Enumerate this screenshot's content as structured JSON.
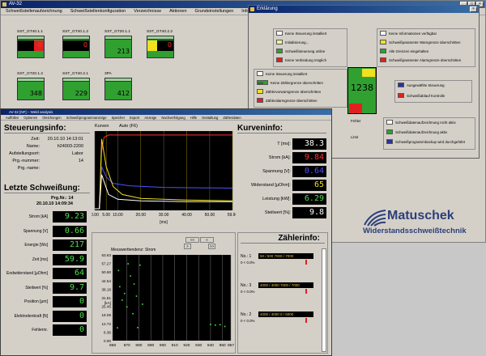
{
  "back_window": {
    "title": "AV-32",
    "menu": [
      "Schweißstellenaufzeichnung",
      "Schweißstellenkonfiguration",
      "Verzeichnisse",
      "Aktionen",
      "Grundeinstellungen",
      "Info"
    ],
    "tiles": [
      {
        "label": "SST_GT40.1.1",
        "value": "0",
        "style": "black-red"
      },
      {
        "label": "SST_GT40.1.2",
        "value": "0",
        "style": "black"
      },
      {
        "label": "SST_GT20.1.1",
        "value": "213",
        "style": "green"
      },
      {
        "label": "SST_GT40.2.2",
        "value": "0",
        "style": "yellow-black"
      },
      {
        "label": "SST_GT20.1.2",
        "value": "348",
        "style": "green"
      },
      {
        "label": "SST_GT40.2.1",
        "value": "229",
        "style": "green"
      },
      {
        "label": "3PA",
        "value": "412",
        "style": "green"
      }
    ]
  },
  "legend_window": {
    "title": "Erklärung",
    "center_value": "1238",
    "left_items": [
      {
        "text": "Keine Steuerung installiert",
        "color": "#ffffff"
      },
      {
        "text": "Initialisierung...",
        "color": "#f0f0a0"
      },
      {
        "text": "Schweißsteuerung online",
        "color": "#30a030"
      },
      {
        "text": "Keine Verbindung möglich",
        "color": "#e02020"
      }
    ],
    "right_items": [
      {
        "text": "Keine Informationen verfügbar",
        "color": "#ffffff"
      },
      {
        "text": "Schweißparameter Warngrenze überschritten",
        "color": "#f0e020"
      },
      {
        "text": "Alle Grenzen eingehalten",
        "color": "#30a030"
      },
      {
        "text": "Schweißparameter Alarmgrenze überschritten",
        "color": "#e02020"
      }
    ],
    "mid_items": [
      {
        "text": "Keine Steuerung installiert",
        "color": "#ffffff",
        "prefix": ""
      },
      {
        "text": "Keine Zählergrenze überschritten",
        "color": "#30a030",
        "prefix": "123"
      },
      {
        "text": "Zählervorwarngrenze überschritten",
        "color": "#f0e020",
        "prefix": ""
      },
      {
        "text": "Zähleralarmgrenze überschritten",
        "color": "#e02020",
        "prefix": ""
      }
    ],
    "side_items": [
      {
        "text": "Ausgewählte Steuerung",
        "color": "#3030a0"
      },
      {
        "text": "Schweißablauf Kontrolle",
        "color": "#e02020"
      }
    ],
    "bottom_items": [
      {
        "text": "Schweißdatenaufzeichnung nicht aktiv",
        "color": "#ffffff"
      },
      {
        "text": "Schweißdatenaufzeichnung aktiv",
        "color": "#30a030"
      },
      {
        "text": "Schweißprogrammbackup wird durchgeführt",
        "color": "#3030a0"
      }
    ],
    "partial_items": [
      "Fehler",
      "Limit"
    ]
  },
  "brand": {
    "name": "Matuschek",
    "subtitle": "Widerstandsschweißtechnik"
  },
  "main_window": {
    "title": "AV-32  [NF] – Weld analysis",
    "menu": [
      "Auffüllen",
      "Optionen",
      "Gleichungen",
      "Schweißprogrammanzeige",
      "Speicher",
      "Export",
      "Anzeige",
      "Nachverfolgung",
      "Hilfe",
      "Gestaltung",
      "Zählerdaten"
    ],
    "steuerung": {
      "heading": "Steuerungsinfo:",
      "rows": [
        {
          "label": "Zeit:",
          "value": "20.10.10 14:13:01"
        },
        {
          "label": "Name:",
          "value": "h24003-2200"
        },
        {
          "label": "Aufstellungsort:",
          "value": "Labor"
        },
        {
          "label": "Prg.-nummer:",
          "value": "14"
        },
        {
          "label": "Prg.-name:",
          "value": ""
        }
      ]
    },
    "weld": {
      "heading": "Letzte Schweißung:",
      "prg": "Prg.Nr.: 14",
      "datetime": "20.10.10     14:09:34",
      "rows": [
        {
          "label": "Strom [kA]",
          "value": "9.23"
        },
        {
          "label": "Spannung [V]",
          "value": "0.66"
        },
        {
          "label": "Energie [Ws]",
          "value": "217"
        },
        {
          "label": "Zeit [ms]",
          "value": "59.9"
        },
        {
          "label": "Endwiderstand [µOhm]",
          "value": "64"
        },
        {
          "label": "Steilwert [%]",
          "value": "9.7"
        },
        {
          "label": "Position [µm]",
          "value": "0"
        },
        {
          "label": "Elektrodenkraft [N]",
          "value": "0"
        },
        {
          "label": "Fehlernr.",
          "value": "0"
        }
      ]
    },
    "curve_tabs": {
      "curves": "Kurven",
      "auto": "Auto (F6)"
    },
    "kurven": {
      "heading": "Kurveninfo:",
      "rows": [
        {
          "label": "T [ms]:",
          "value": "38.3",
          "color": "#ffffff",
          "bg": "#000"
        },
        {
          "label": "Strom [kA]:",
          "value": "9.84",
          "color": "#ff3030",
          "bg": "#000"
        },
        {
          "label": "Spannung [V]:",
          "value": "0.64",
          "color": "#5050ff",
          "bg": "#000"
        },
        {
          "label": "Widerstand [µOhm]:",
          "value": "65",
          "color": "#f0e020",
          "bg": "#000"
        },
        {
          "label": "Leistung [kW]:",
          "value": "6.29",
          "color": "#4fe04f",
          "bg": "#000"
        },
        {
          "label": "Steilwert [%]:",
          "value": "9.8",
          "color": "#ffffff",
          "bg": "#000"
        }
      ]
    },
    "trend": {
      "title": "Messwerttendenz:  Strom",
      "nav": [
        "<<",
        "<",
        ">",
        ">>"
      ]
    },
    "zaehler": {
      "heading": "Zählerinfo:",
      "rows": [
        {
          "no": "No.: 1",
          "text": "50 / 500   7000 / 7000",
          "pct": "0 < 0.0%"
        },
        {
          "no": "No.: 3",
          "text": "4000 / 4000   7000 / 7000",
          "pct": "0 < 0.0%"
        },
        {
          "no": "No.: 2",
          "text": "4000 / 4000   0 / 5000",
          "pct": "0 < 0.0%"
        }
      ]
    }
  },
  "chart_data": [
    {
      "type": "line",
      "title": "",
      "xlabel": "[ms]",
      "ylabel": "",
      "x_ticks": [
        "0.00",
        "5.00",
        "10.00",
        "20.00",
        "30.00",
        "40.00",
        "50.00",
        "59.90"
      ],
      "xlim": [
        0,
        59.9
      ],
      "grid": true,
      "series": [
        {
          "color": "#ff3030",
          "x": [
            0,
            2,
            3,
            4,
            6,
            10,
            20,
            40,
            59.9
          ],
          "y": [
            0.02,
            0.02,
            0.75,
            0.92,
            0.95,
            0.95,
            0.95,
            0.95,
            0.95
          ]
        },
        {
          "color": "#5050ff",
          "x": [
            0,
            2,
            3,
            5,
            8,
            15,
            30,
            59.9
          ],
          "y": [
            0.02,
            0.02,
            0.55,
            0.42,
            0.34,
            0.31,
            0.29,
            0.28
          ]
        },
        {
          "color": "#f0e020",
          "x": [
            0,
            2,
            3,
            5,
            8,
            12,
            20,
            40,
            59.9
          ],
          "y": [
            0.02,
            0.02,
            0.9,
            0.55,
            0.3,
            0.2,
            0.15,
            0.13,
            0.12
          ]
        },
        {
          "color": "#ffffff",
          "x": [
            0,
            2,
            3,
            6,
            10,
            20,
            40,
            59.9
          ],
          "y": [
            0.02,
            0.02,
            0.45,
            0.2,
            0.14,
            0.12,
            0.11,
            0.11
          ]
        }
      ]
    },
    {
      "type": "scatter",
      "title": "Messwerttendenz:  Strom",
      "xlabel": "",
      "ylabel": "[kA]",
      "y_ticks": [
        "63.63",
        "57.27",
        "50.90",
        "44.54",
        "38.18",
        "31.81",
        "25.45",
        "19.09",
        "12.72",
        "6.36",
        "0.00"
      ],
      "ylim": [
        0,
        63.63
      ],
      "x_ticks": [
        "858",
        "870",
        "880",
        "890",
        "900",
        "910",
        "920",
        "930",
        "940",
        "950",
        "957"
      ],
      "xlim": [
        858,
        957
      ],
      "points": [
        {
          "x": 862,
          "y": 9.5
        },
        {
          "x": 863,
          "y": 52
        },
        {
          "x": 864,
          "y": 40
        },
        {
          "x": 866,
          "y": 30
        },
        {
          "x": 868,
          "y": 35
        },
        {
          "x": 870,
          "y": 25
        },
        {
          "x": 871,
          "y": 57
        },
        {
          "x": 873,
          "y": 48
        },
        {
          "x": 875,
          "y": 20
        },
        {
          "x": 876,
          "y": 42
        },
        {
          "x": 878,
          "y": 33
        },
        {
          "x": 879,
          "y": 9.7
        },
        {
          "x": 881,
          "y": 56
        },
        {
          "x": 883,
          "y": 27
        },
        {
          "x": 940,
          "y": 12
        },
        {
          "x": 944,
          "y": 11.5
        },
        {
          "x": 948,
          "y": 11.8
        },
        {
          "x": 952,
          "y": 10.5
        }
      ]
    }
  ]
}
